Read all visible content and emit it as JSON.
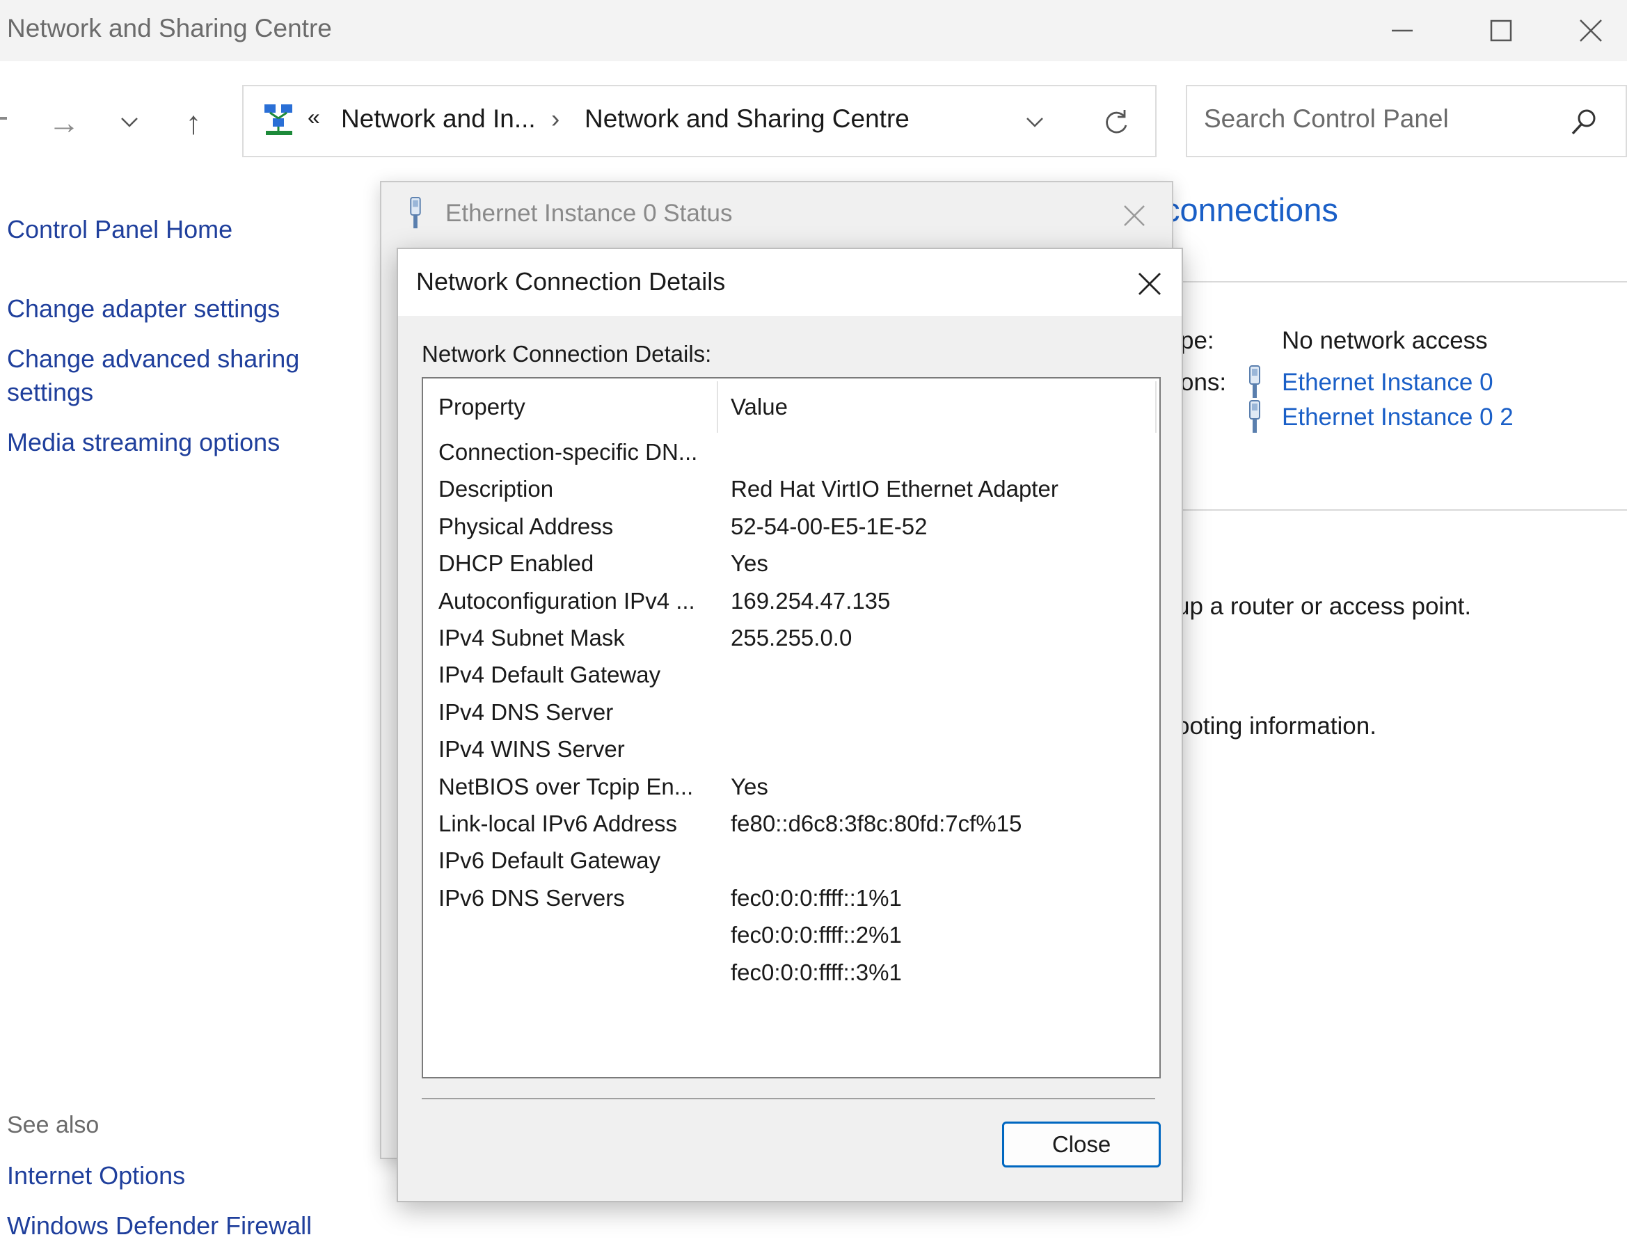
{
  "window": {
    "title": "Network and Sharing Centre",
    "minimize_glyph": "—",
    "maximize_glyph": "☐",
    "close_glyph": "✕"
  },
  "nav": {
    "forward_glyph": "→",
    "recent_glyph": "⌄",
    "up_glyph": "↑",
    "overflow_glyph": "«",
    "separator_glyph": "›",
    "breadcrumb_1": "Network and In...",
    "breadcrumb_2": "Network and Sharing Centre",
    "search_placeholder": "Search Control Panel"
  },
  "sidebar": {
    "home": "Control Panel Home",
    "items": [
      "Change adapter settings",
      "Change advanced sharing settings",
      "Media streaming options"
    ],
    "see_also_heading": "See also",
    "see_also": [
      "Internet Options",
      "Windows Defender Firewall"
    ]
  },
  "main": {
    "heading_fragment": "connections",
    "access_type_fragment": "pe:",
    "access_type_value": "No network access",
    "connections_fragment": "ons:",
    "connections": [
      "Ethernet Instance 0",
      "Ethernet Instance 0 2"
    ],
    "router_text_fragment": "up a router or access point.",
    "troubleshoot_text_fragment": "ooting information."
  },
  "status_dialog": {
    "title": "Ethernet Instance 0 Status"
  },
  "details_dialog": {
    "title": "Network Connection Details",
    "caption": "Network Connection Details:",
    "columns": [
      "Property",
      "Value"
    ],
    "rows": [
      [
        "Connection-specific DN...",
        ""
      ],
      [
        "Description",
        "Red Hat VirtIO Ethernet Adapter"
      ],
      [
        "Physical Address",
        "52-54-00-E5-1E-52"
      ],
      [
        "DHCP Enabled",
        "Yes"
      ],
      [
        "Autoconfiguration IPv4 ...",
        "169.254.47.135"
      ],
      [
        "IPv4 Subnet Mask",
        "255.255.0.0"
      ],
      [
        "IPv4 Default Gateway",
        ""
      ],
      [
        "IPv4 DNS Server",
        ""
      ],
      [
        "IPv4 WINS Server",
        ""
      ],
      [
        "NetBIOS over Tcpip En...",
        "Yes"
      ],
      [
        "Link-local IPv6 Address",
        "fe80::d6c8:3f8c:80fd:7cf%15"
      ],
      [
        "IPv6 Default Gateway",
        ""
      ],
      [
        "IPv6 DNS Servers",
        "fec0:0:0:ffff::1%1"
      ],
      [
        "",
        "fec0:0:0:ffff::2%1"
      ],
      [
        "",
        "fec0:0:0:ffff::3%1"
      ]
    ],
    "close_label": "Close"
  }
}
